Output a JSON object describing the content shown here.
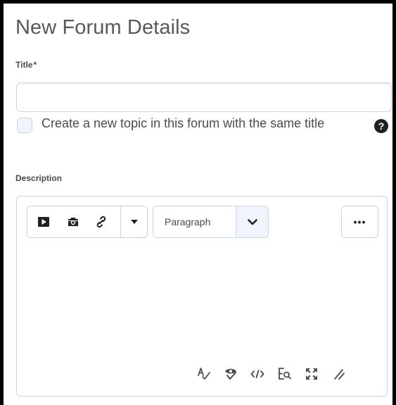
{
  "header": {
    "title": "New Forum Details"
  },
  "title_field": {
    "label": "Title",
    "required_mark": "*",
    "value": "",
    "placeholder": ""
  },
  "same_title_checkbox": {
    "label": "Create a new topic in this forum with the same title",
    "checked": false,
    "help_icon": "?"
  },
  "description": {
    "label": "Description",
    "toolbar": {
      "insert_buttons": [
        "video-icon",
        "camera-icon",
        "link-icon",
        "caret-down-icon"
      ],
      "format_select": {
        "selected": "Paragraph"
      },
      "more_label": "•••"
    },
    "bottom_tools": [
      "spellcheck-icon",
      "accessibility-check-icon",
      "source-code-icon",
      "preview-icon",
      "fullscreen-icon",
      "resize-icon"
    ]
  },
  "colors": {
    "border": "#cdd5dc",
    "text": "#494c4e",
    "icon": "#202122",
    "select_bg": "#f1f5fb"
  }
}
